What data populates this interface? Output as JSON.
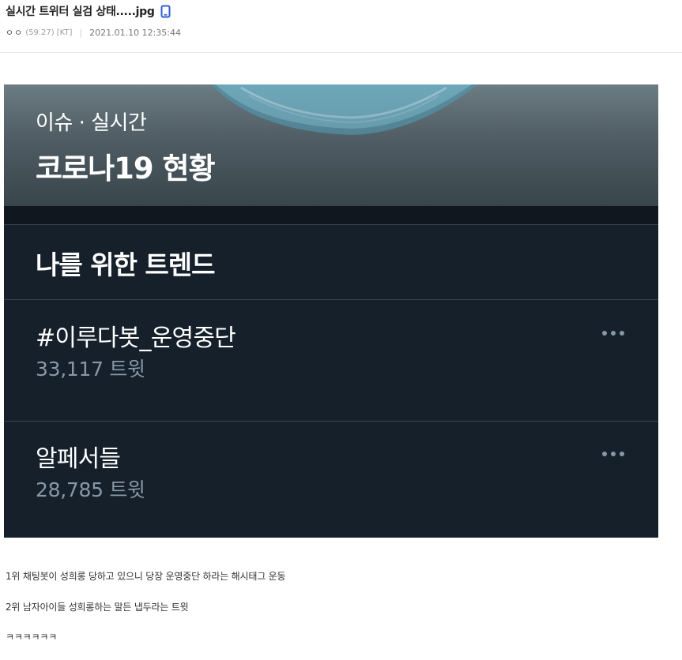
{
  "post": {
    "title": "실시간 트위터 실검 상태.....jpg",
    "author": "ㅇㅇ",
    "author_score": "(59.27)",
    "author_isp": "[KT]",
    "separator": "|",
    "date": "2021.01.10 12:35:44"
  },
  "screenshot": {
    "banner_subtitle": "이슈 · 실시간",
    "banner_title": "코로나19 현황",
    "section_heading": "나를 위한 트렌드",
    "trends": [
      {
        "name": "#이루다봇_운영중단",
        "count": "33,117 트윗"
      },
      {
        "name": "알페서들",
        "count": "28,785 트윗"
      }
    ]
  },
  "body": {
    "lines": [
      "1위 채팅봇이 성희롱 당하고 있으니 당장 운영중단 하라는 해시태그 운동",
      "2위 남자아이들 성희롱하는 말든 냅두라는 트윗",
      "ㅋㅋㅋㅋㅋㅋ"
    ]
  },
  "colors": {
    "twitter_bg": "#15202b",
    "twitter_border": "#38444d",
    "twitter_secondary": "#8899a6",
    "mobile_icon": "#2e5fd4"
  }
}
